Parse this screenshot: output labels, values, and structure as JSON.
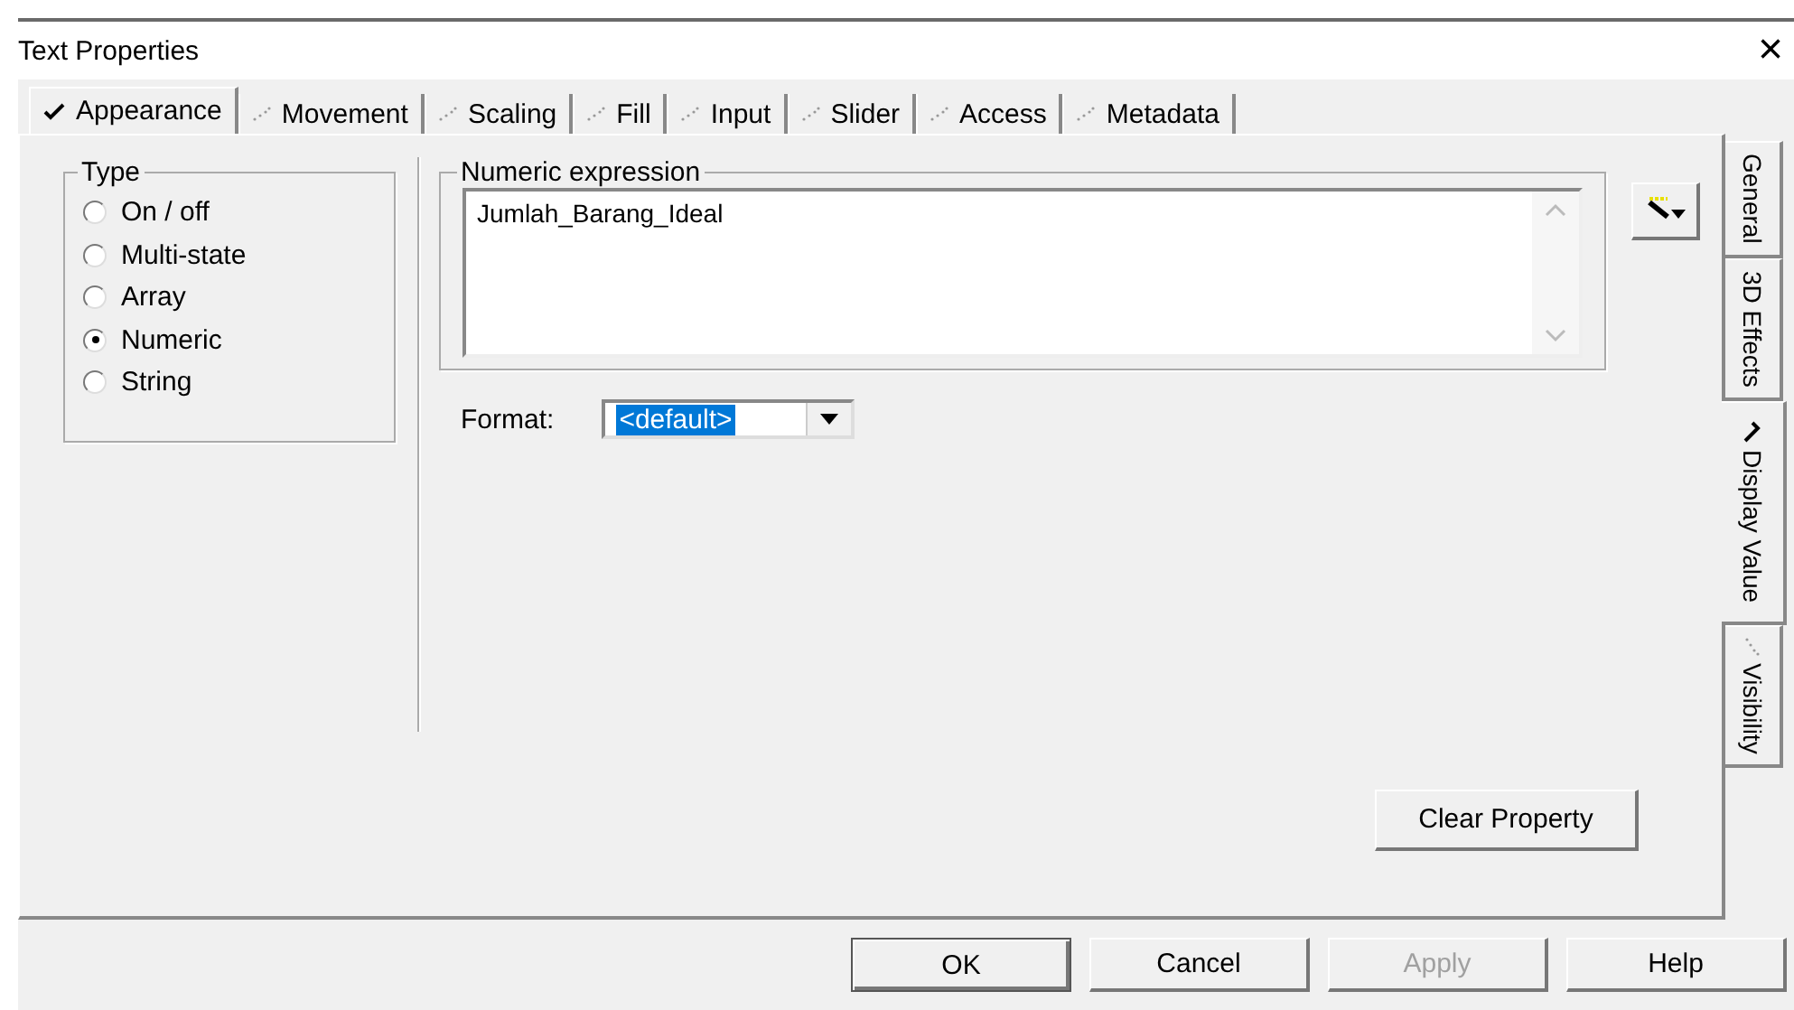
{
  "window": {
    "title": "Text Properties",
    "close": "×"
  },
  "tabs": [
    {
      "label": "Appearance",
      "selected": true
    },
    {
      "label": "Movement",
      "selected": false
    },
    {
      "label": "Scaling",
      "selected": false
    },
    {
      "label": "Fill",
      "selected": false
    },
    {
      "label": "Input",
      "selected": false
    },
    {
      "label": "Slider",
      "selected": false
    },
    {
      "label": "Access",
      "selected": false
    },
    {
      "label": "Metadata",
      "selected": false
    }
  ],
  "side_tabs": [
    {
      "label": "General",
      "selected": false,
      "kind": "plain"
    },
    {
      "label": "3D Effects",
      "selected": false,
      "kind": "plain"
    },
    {
      "label": "Display Value",
      "selected": true,
      "kind": "marked"
    },
    {
      "label": "Visibility",
      "selected": false,
      "kind": "marked"
    }
  ],
  "type_group": {
    "label": "Type",
    "options": [
      {
        "label": "On / off",
        "selected": false
      },
      {
        "label": "Multi-state",
        "selected": false
      },
      {
        "label": "Array",
        "selected": false
      },
      {
        "label": "Numeric",
        "selected": true
      },
      {
        "label": "String",
        "selected": false
      }
    ]
  },
  "expression_group": {
    "label": "Numeric expression",
    "value": "Jumlah_Barang_Ideal"
  },
  "format": {
    "label": "Format:",
    "value": "<default>"
  },
  "clear_button": "Clear Property",
  "buttons": [
    {
      "label": "OK",
      "disabled": false,
      "default": true
    },
    {
      "label": "Cancel",
      "disabled": false,
      "default": false
    },
    {
      "label": "Apply",
      "disabled": true,
      "default": false
    },
    {
      "label": "Help",
      "disabled": false,
      "default": false
    }
  ]
}
